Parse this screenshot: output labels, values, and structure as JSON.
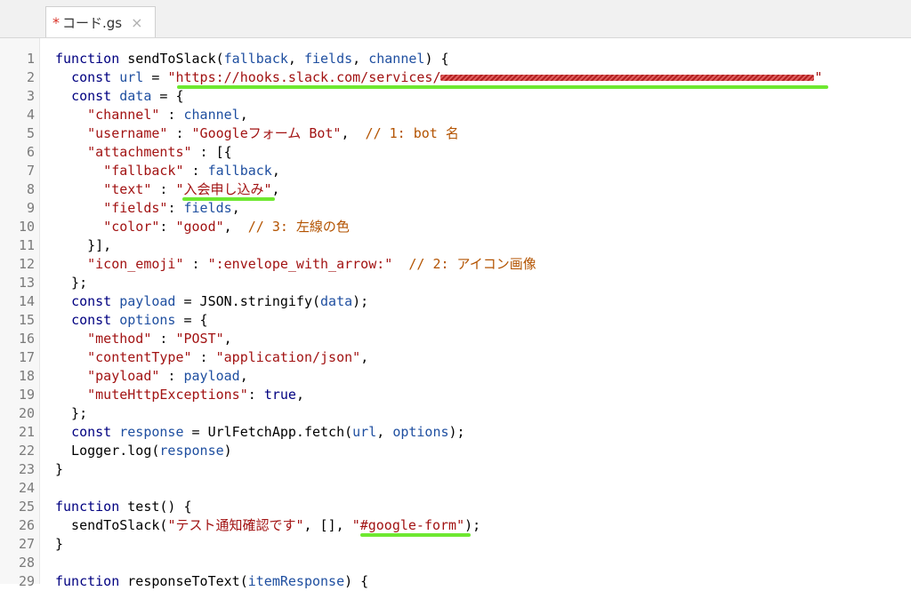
{
  "tab": {
    "modified_marker": "*",
    "filename": "コード.gs",
    "close_glyph": "×"
  },
  "code_lines": [
    {
      "n": "1",
      "segments": [
        {
          "c": "kw",
          "t": "function"
        },
        {
          "c": "",
          "t": " sendToSlack("
        },
        {
          "c": "id",
          "t": "fallback"
        },
        {
          "c": "",
          "t": ", "
        },
        {
          "c": "id",
          "t": "fields"
        },
        {
          "c": "",
          "t": ", "
        },
        {
          "c": "id",
          "t": "channel"
        },
        {
          "c": "",
          "t": ") {"
        }
      ]
    },
    {
      "n": "2",
      "segments": [
        {
          "c": "",
          "t": "  "
        },
        {
          "c": "kw",
          "t": "const"
        },
        {
          "c": "",
          "t": " "
        },
        {
          "c": "id",
          "t": "url"
        },
        {
          "c": "",
          "t": " = "
        },
        {
          "c": "str",
          "t": "\"https://hooks.slack.com/services/"
        },
        {
          "c": "redacted",
          "t": ""
        },
        {
          "c": "str",
          "t": "\""
        }
      ]
    },
    {
      "n": "3",
      "segments": [
        {
          "c": "",
          "t": "  "
        },
        {
          "c": "kw",
          "t": "const"
        },
        {
          "c": "",
          "t": " "
        },
        {
          "c": "id",
          "t": "data"
        },
        {
          "c": "",
          "t": " = {"
        }
      ]
    },
    {
      "n": "4",
      "segments": [
        {
          "c": "",
          "t": "    "
        },
        {
          "c": "str",
          "t": "\"channel\""
        },
        {
          "c": "",
          "t": " : "
        },
        {
          "c": "id",
          "t": "channel"
        },
        {
          "c": "",
          "t": ","
        }
      ]
    },
    {
      "n": "5",
      "segments": [
        {
          "c": "",
          "t": "    "
        },
        {
          "c": "str",
          "t": "\"username\""
        },
        {
          "c": "",
          "t": " : "
        },
        {
          "c": "str",
          "t": "\"Googleフォーム Bot\""
        },
        {
          "c": "",
          "t": ",  "
        },
        {
          "c": "cm",
          "t": "// 1: bot 名"
        }
      ]
    },
    {
      "n": "6",
      "segments": [
        {
          "c": "",
          "t": "    "
        },
        {
          "c": "str",
          "t": "\"attachments\""
        },
        {
          "c": "",
          "t": " : [{"
        }
      ]
    },
    {
      "n": "7",
      "segments": [
        {
          "c": "",
          "t": "      "
        },
        {
          "c": "str",
          "t": "\"fallback\""
        },
        {
          "c": "",
          "t": " : "
        },
        {
          "c": "id",
          "t": "fallback"
        },
        {
          "c": "",
          "t": ","
        }
      ]
    },
    {
      "n": "8",
      "segments": [
        {
          "c": "",
          "t": "      "
        },
        {
          "c": "str",
          "t": "\"text\""
        },
        {
          "c": "",
          "t": " : "
        },
        {
          "c": "str",
          "t": "\"入会申し込み\""
        },
        {
          "c": "",
          "t": ","
        }
      ]
    },
    {
      "n": "9",
      "segments": [
        {
          "c": "",
          "t": "      "
        },
        {
          "c": "str",
          "t": "\"fields\""
        },
        {
          "c": "",
          "t": ": "
        },
        {
          "c": "id",
          "t": "fields"
        },
        {
          "c": "",
          "t": ","
        }
      ]
    },
    {
      "n": "10",
      "segments": [
        {
          "c": "",
          "t": "      "
        },
        {
          "c": "str",
          "t": "\"color\""
        },
        {
          "c": "",
          "t": ": "
        },
        {
          "c": "str",
          "t": "\"good\""
        },
        {
          "c": "",
          "t": ",  "
        },
        {
          "c": "cm",
          "t": "// 3: 左線の色"
        }
      ]
    },
    {
      "n": "11",
      "segments": [
        {
          "c": "",
          "t": "    }],"
        }
      ]
    },
    {
      "n": "12",
      "segments": [
        {
          "c": "",
          "t": "    "
        },
        {
          "c": "str",
          "t": "\"icon_emoji\""
        },
        {
          "c": "",
          "t": " : "
        },
        {
          "c": "str",
          "t": "\":envelope_with_arrow:\""
        },
        {
          "c": "",
          "t": "  "
        },
        {
          "c": "cm",
          "t": "// 2: アイコン画像"
        }
      ]
    },
    {
      "n": "13",
      "segments": [
        {
          "c": "",
          "t": "  };"
        }
      ]
    },
    {
      "n": "14",
      "segments": [
        {
          "c": "",
          "t": "  "
        },
        {
          "c": "kw",
          "t": "const"
        },
        {
          "c": "",
          "t": " "
        },
        {
          "c": "id",
          "t": "payload"
        },
        {
          "c": "",
          "t": " = JSON.stringify("
        },
        {
          "c": "id",
          "t": "data"
        },
        {
          "c": "",
          "t": ");"
        }
      ]
    },
    {
      "n": "15",
      "segments": [
        {
          "c": "",
          "t": "  "
        },
        {
          "c": "kw",
          "t": "const"
        },
        {
          "c": "",
          "t": " "
        },
        {
          "c": "id",
          "t": "options"
        },
        {
          "c": "",
          "t": " = {"
        }
      ]
    },
    {
      "n": "16",
      "segments": [
        {
          "c": "",
          "t": "    "
        },
        {
          "c": "str",
          "t": "\"method\""
        },
        {
          "c": "",
          "t": " : "
        },
        {
          "c": "str",
          "t": "\"POST\""
        },
        {
          "c": "",
          "t": ","
        }
      ]
    },
    {
      "n": "17",
      "segments": [
        {
          "c": "",
          "t": "    "
        },
        {
          "c": "str",
          "t": "\"contentType\""
        },
        {
          "c": "",
          "t": " : "
        },
        {
          "c": "str",
          "t": "\"application/json\""
        },
        {
          "c": "",
          "t": ","
        }
      ]
    },
    {
      "n": "18",
      "segments": [
        {
          "c": "",
          "t": "    "
        },
        {
          "c": "str",
          "t": "\"payload\""
        },
        {
          "c": "",
          "t": " : "
        },
        {
          "c": "id",
          "t": "payload"
        },
        {
          "c": "",
          "t": ","
        }
      ]
    },
    {
      "n": "19",
      "segments": [
        {
          "c": "",
          "t": "    "
        },
        {
          "c": "str",
          "t": "\"muteHttpExceptions\""
        },
        {
          "c": "",
          "t": ": "
        },
        {
          "c": "kw",
          "t": "true"
        },
        {
          "c": "",
          "t": ","
        }
      ]
    },
    {
      "n": "20",
      "segments": [
        {
          "c": "",
          "t": "  };"
        }
      ]
    },
    {
      "n": "21",
      "segments": [
        {
          "c": "",
          "t": "  "
        },
        {
          "c": "kw",
          "t": "const"
        },
        {
          "c": "",
          "t": " "
        },
        {
          "c": "id",
          "t": "response"
        },
        {
          "c": "",
          "t": " = UrlFetchApp.fetch("
        },
        {
          "c": "id",
          "t": "url"
        },
        {
          "c": "",
          "t": ", "
        },
        {
          "c": "id",
          "t": "options"
        },
        {
          "c": "",
          "t": ");"
        }
      ]
    },
    {
      "n": "22",
      "segments": [
        {
          "c": "",
          "t": "  Logger.log("
        },
        {
          "c": "id",
          "t": "response"
        },
        {
          "c": "",
          "t": ")"
        }
      ]
    },
    {
      "n": "23",
      "segments": [
        {
          "c": "",
          "t": "}"
        }
      ]
    },
    {
      "n": "24",
      "segments": []
    },
    {
      "n": "25",
      "segments": [
        {
          "c": "kw",
          "t": "function"
        },
        {
          "c": "",
          "t": " test() {"
        }
      ]
    },
    {
      "n": "26",
      "segments": [
        {
          "c": "",
          "t": "  sendToSlack("
        },
        {
          "c": "str",
          "t": "\"テスト通知確認です\""
        },
        {
          "c": "",
          "t": ", [], "
        },
        {
          "c": "str",
          "t": "\"#google-form\""
        },
        {
          "c": "",
          "t": ");"
        }
      ]
    },
    {
      "n": "27",
      "segments": [
        {
          "c": "",
          "t": "}"
        }
      ]
    },
    {
      "n": "28",
      "segments": []
    },
    {
      "n": "29",
      "segments": [
        {
          "c": "kw",
          "t": "function"
        },
        {
          "c": "",
          "t": " responseToText("
        },
        {
          "c": "id",
          "t": "itemResponse"
        },
        {
          "c": "",
          "t": ") {"
        }
      ]
    }
  ],
  "colors": {
    "highlight": "#6ee830",
    "string": "#a21313",
    "comment": "#b35300",
    "keyword": "#000080",
    "identifier": "#1f4fa0"
  }
}
